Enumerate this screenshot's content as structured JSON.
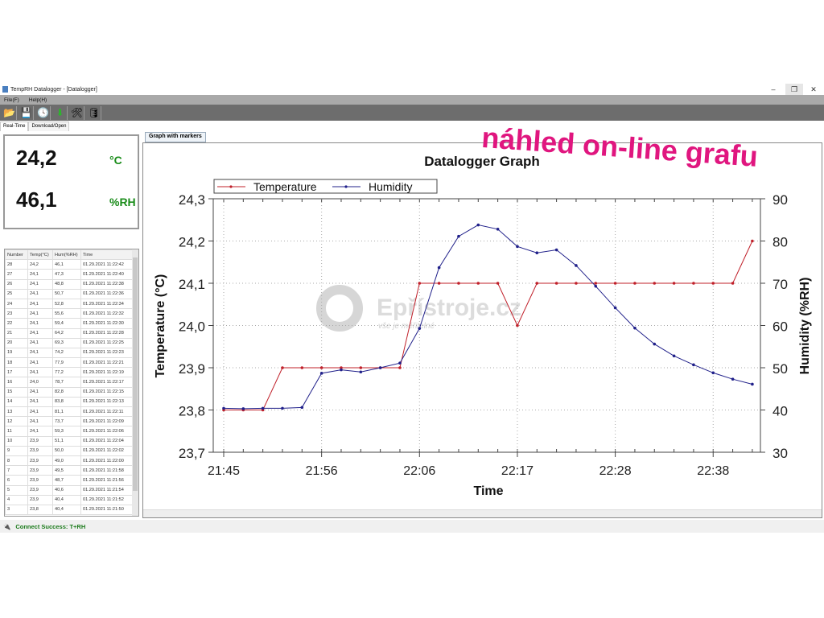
{
  "window": {
    "title": "TempRH Datalogger - [Datalogger]",
    "minimize": "–",
    "restore": "❐",
    "close": "✕"
  },
  "menu": [
    "File(F)",
    "Help(H)"
  ],
  "toolbar": [
    {
      "icon": "folder-icon",
      "glyph": "📂"
    },
    {
      "icon": "save-icon",
      "glyph": "💾"
    },
    {
      "icon": "clock-icon",
      "glyph": "🕓"
    },
    {
      "icon": "download-icon",
      "glyph": "⬇"
    },
    {
      "icon": "tools-icon",
      "glyph": "🛠"
    },
    {
      "icon": "database-icon",
      "glyph": "🛢"
    }
  ],
  "tabs": [
    "Real-Time",
    "Download/Open"
  ],
  "readout": {
    "temp": "24,2",
    "temp_unit": "°C",
    "hum": "46,1",
    "hum_unit": "%RH"
  },
  "table": {
    "headers": [
      "Number",
      "Temp(°C)",
      "Hum(%RH)",
      "Time"
    ],
    "rows": [
      [
        "28",
        "24,2",
        "46,1",
        "01.29.2021 11:22:42"
      ],
      [
        "27",
        "24,1",
        "47,3",
        "01.29.2021 11:22:40"
      ],
      [
        "26",
        "24,1",
        "48,8",
        "01.29.2021 11:22:38"
      ],
      [
        "25",
        "24,1",
        "50,7",
        "01.29.2021 11:22:36"
      ],
      [
        "24",
        "24,1",
        "52,8",
        "01.29.2021 11:22:34"
      ],
      [
        "23",
        "24,1",
        "55,6",
        "01.29.2021 11:22:32"
      ],
      [
        "22",
        "24,1",
        "59,4",
        "01.29.2021 11:22:30"
      ],
      [
        "21",
        "24,1",
        "64,2",
        "01.29.2021 11:22:28"
      ],
      [
        "20",
        "24,1",
        "69,3",
        "01.29.2021 11:22:25"
      ],
      [
        "19",
        "24,1",
        "74,2",
        "01.29.2021 11:22:23"
      ],
      [
        "18",
        "24,1",
        "77,9",
        "01.29.2021 11:22:21"
      ],
      [
        "17",
        "24,1",
        "77,2",
        "01.29.2021 11:22:19"
      ],
      [
        "16",
        "24,0",
        "78,7",
        "01.29.2021 11:22:17"
      ],
      [
        "15",
        "24,1",
        "82,8",
        "01.29.2021 11:22:15"
      ],
      [
        "14",
        "24,1",
        "83,8",
        "01.29.2021 11:22:13"
      ],
      [
        "13",
        "24,1",
        "81,1",
        "01.29.2021 11:22:11"
      ],
      [
        "12",
        "24,1",
        "73,7",
        "01.29.2021 11:22:09"
      ],
      [
        "11",
        "24,1",
        "59,3",
        "01.29.2021 11:22:06"
      ],
      [
        "10",
        "23,9",
        "51,1",
        "01.29.2021 11:22:04"
      ],
      [
        "9",
        "23,9",
        "50,0",
        "01.29.2021 11:22:02"
      ],
      [
        "8",
        "23,9",
        "49,0",
        "01.29.2021 11:22:00"
      ],
      [
        "7",
        "23,9",
        "49,5",
        "01.29.2021 11:21:58"
      ],
      [
        "6",
        "23,9",
        "48,7",
        "01.29.2021 11:21:56"
      ],
      [
        "5",
        "23,9",
        "40,6",
        "01.29.2021 11:21:54"
      ],
      [
        "4",
        "23,9",
        "40,4",
        "01.29.2021 11:21:52"
      ],
      [
        "3",
        "23,8",
        "40,4",
        "01.29.2021 11:21:50"
      ]
    ]
  },
  "graph_tab": "Graph with markers",
  "status": "Connect Success: T+RH",
  "overlay": "náhled on-line grafu",
  "watermark": {
    "brand": "Epřístroje.cz",
    "slogan": "vše je měřitelné"
  },
  "chart_data": {
    "type": "line",
    "title": "Datalogger Graph",
    "xlabel": "Time",
    "ylabel": "Temperature (°C)",
    "y2label": "Humidity (%RH)",
    "ylim": [
      23.7,
      24.3
    ],
    "y2lim": [
      30,
      90
    ],
    "grid": true,
    "legend": "top-left",
    "yticks": [
      "23,7",
      "23,8",
      "23,9",
      "24,0",
      "24,1",
      "24,2",
      "24,3"
    ],
    "y2ticks": [
      "30",
      "40",
      "50",
      "60",
      "70",
      "80",
      "90"
    ],
    "xticks": [
      {
        "index": 1,
        "label": "21:45"
      },
      {
        "index": 6,
        "label": "21:56"
      },
      {
        "index": 11,
        "label": "22:06"
      },
      {
        "index": 16,
        "label": "22:17"
      },
      {
        "index": 21,
        "label": "22:28"
      },
      {
        "index": 26,
        "label": "22:38"
      }
    ],
    "series": [
      {
        "name": "Temperature",
        "color": "#c0202a",
        "axis": "left",
        "values": [
          23.8,
          23.8,
          23.8,
          23.9,
          23.9,
          23.9,
          23.9,
          23.9,
          23.9,
          23.9,
          24.1,
          24.1,
          24.1,
          24.1,
          24.1,
          24.0,
          24.1,
          24.1,
          24.1,
          24.1,
          24.1,
          24.1,
          24.1,
          24.1,
          24.1,
          24.1,
          24.1,
          24.2
        ]
      },
      {
        "name": "Humidity",
        "color": "#20208a",
        "axis": "right",
        "values": [
          40.4,
          40.3,
          40.4,
          40.4,
          40.6,
          48.7,
          49.5,
          49.0,
          50.0,
          51.1,
          59.3,
          73.7,
          81.1,
          83.8,
          82.8,
          78.7,
          77.2,
          77.9,
          74.2,
          69.3,
          64.2,
          59.4,
          55.6,
          52.8,
          50.7,
          48.8,
          47.3,
          46.1
        ]
      }
    ]
  }
}
